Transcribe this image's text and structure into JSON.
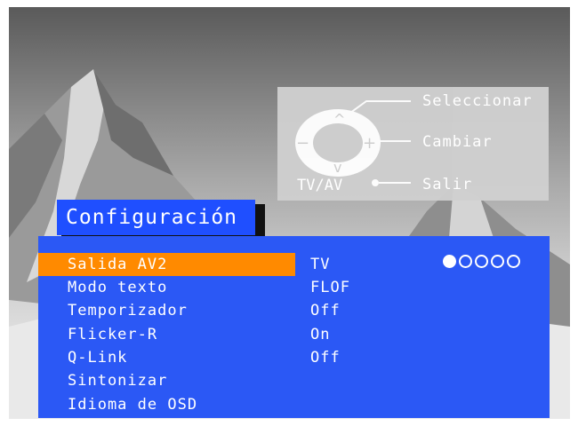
{
  "remote_legend": {
    "select_label": "Seleccionar",
    "change_label": "Cambiar",
    "exit_label": "Salir",
    "tvav_label": "TV/AV"
  },
  "menu": {
    "title": "Configuración",
    "items": [
      {
        "label": "Salida AV2",
        "value": "TV",
        "selected": true
      },
      {
        "label": "Modo texto",
        "value": "FLOF"
      },
      {
        "label": "Temporizador",
        "value": "Off"
      },
      {
        "label": "Flicker-R",
        "value": "On"
      },
      {
        "label": "Q-Link",
        "value": "Off"
      },
      {
        "label": "Sintonizar",
        "value": ""
      },
      {
        "label": "Idioma de OSD",
        "value": ""
      }
    ],
    "option_count": 5,
    "option_selected_index": 0
  },
  "colors": {
    "panel": "#2b58f5",
    "highlight": "#ff8a00",
    "title_bg": "#1f4fff"
  }
}
